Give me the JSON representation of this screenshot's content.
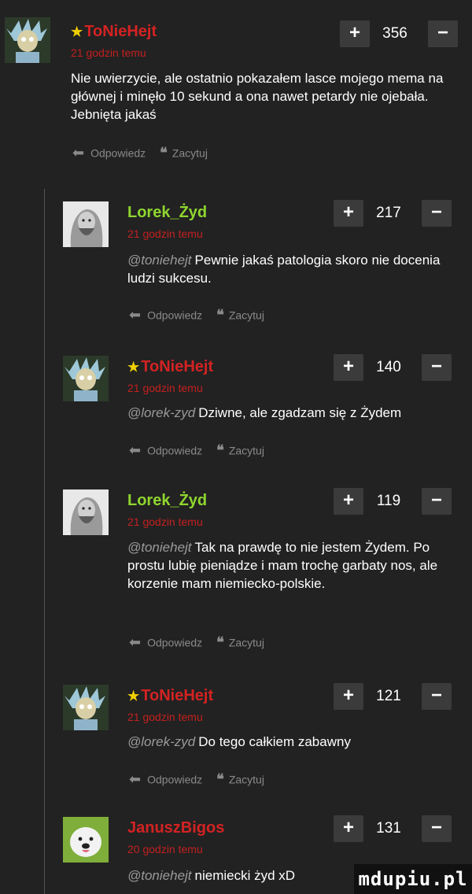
{
  "comments": [
    {
      "author": "ToNieHejt",
      "starred": true,
      "time": "21 godzin temu",
      "mention": "",
      "text": "Nie uwierzycie, ale ostatnio pokazałem lasce mojego mema na głównej i minęło 10 sekund a ona nawet petardy nie ojebała. Jebnięta jakaś",
      "score": "356",
      "reply_label": "Odpowiedz",
      "quote_label": "Zacytuj"
    },
    {
      "author": "Lorek_Żyd",
      "starred": false,
      "time": "21 godzin temu",
      "mention": "@toniehejt",
      "text": "Pewnie jakaś patologia skoro nie docenia ludzi sukcesu.",
      "score": "217",
      "reply_label": "Odpowiedz",
      "quote_label": "Zacytuj"
    },
    {
      "author": "ToNieHejt",
      "starred": true,
      "time": "21 godzin temu",
      "mention": "@lorek-zyd",
      "text": "Dziwne, ale zgadzam się z Żydem",
      "score": "140",
      "reply_label": "Odpowiedz",
      "quote_label": "Zacytuj"
    },
    {
      "author": "Lorek_Żyd",
      "starred": false,
      "time": "21 godzin temu",
      "mention": "@toniehejt",
      "text": "Tak na prawdę to nie jestem Żydem. Po prostu lubię pieniądze i mam trochę garbaty nos, ale korzenie mam niemiecko-polskie.",
      "score": "119",
      "reply_label": "Odpowiedz",
      "quote_label": "Zacytuj"
    },
    {
      "author": "ToNieHejt",
      "starred": true,
      "time": "21 godzin temu",
      "mention": "@lorek-zyd",
      "text": "Do tego całkiem zabawny",
      "score": "121",
      "reply_label": "Odpowiedz",
      "quote_label": "Zacytuj"
    },
    {
      "author": "JanuszBigos",
      "starred": false,
      "time": "20 godzin temu",
      "mention": "@toniehejt",
      "text": "niemiecki żyd xD",
      "score": "131",
      "reply_label": "",
      "quote_label": ""
    }
  ],
  "vote": {
    "plus": "+",
    "minus": "−"
  },
  "icons": {
    "star": "star-icon",
    "reply": "reply-arrow-icon",
    "quote": "quote-icon"
  },
  "colors": {
    "gold_author": "#d42222",
    "green_author": "#8fd62e",
    "time": "#c3201f",
    "background": "#222222"
  },
  "watermark": "mdupiu.pl"
}
